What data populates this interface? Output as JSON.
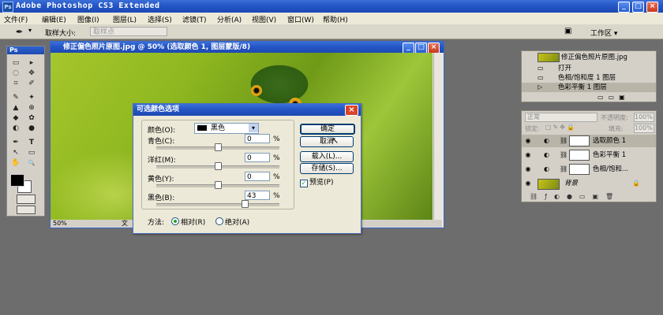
{
  "app": {
    "title": "Adobe Photoshop CS3 Extended",
    "logo": "Ps",
    "window_buttons": [
      "_",
      "□",
      "×"
    ]
  },
  "menu": [
    "文件(F)",
    "编辑(E)",
    "图像(I)",
    "图层(L)",
    "选择(S)",
    "滤镜(T)",
    "分析(A)",
    "视图(V)",
    "窗口(W)",
    "帮助(H)"
  ],
  "options_bar": {
    "sample_label": "取样大小:",
    "sample_value": "取样点",
    "workspace_label": "工作区 ▾"
  },
  "toolbox": {
    "header": "Ps",
    "tools": [
      "▭",
      "▸",
      "◌",
      "✥",
      "⌗",
      "✐",
      "✎",
      "✦",
      "▲",
      "⊕",
      "◆",
      "✿",
      "◐",
      "●",
      "✒",
      "T",
      "↖",
      "▭",
      "✋",
      "🔍"
    ]
  },
  "document": {
    "title": "修正偏色照片原图.jpg @ 50% (选取颜色 1, 图层蒙版/8)",
    "zoom": "50%",
    "status_fragment": "文"
  },
  "dialog": {
    "title": "可选颜色选项",
    "color_label": "颜色(O):",
    "color_value": "黑色",
    "sliders": [
      {
        "label": "青色(C):",
        "value": "0",
        "unit": "%",
        "level": 0.5
      },
      {
        "label": "洋红(M):",
        "value": "0",
        "unit": "%",
        "level": 0.5
      },
      {
        "label": "黄色(Y):",
        "value": "0",
        "unit": "%",
        "level": 0.5
      },
      {
        "label": "黑色(B):",
        "value": "43",
        "unit": "%",
        "level": 0.715
      }
    ],
    "buttons": {
      "ok": "确定",
      "cancel": "取消",
      "load": "载入(L)...",
      "save": "存储(S)..."
    },
    "preview_label": "预览(P)",
    "method_label": "方法:",
    "relative_label": "相对(R)",
    "absolute_label": "绝对(A)"
  },
  "history_panel": {
    "snapshot": "修正偏色照片原图.jpg",
    "items": [
      "打开",
      "色相/饱和度 1 图层",
      "色彩平衡 1 图层"
    ]
  },
  "layers_panel": {
    "blend_mode": "正常",
    "opacity_label": "不透明度:",
    "opacity_value": "100%",
    "lock_label": "锁定:",
    "fill_label": "填充:",
    "fill_value": "100%",
    "layers": [
      {
        "name": "选取颜色 1",
        "selected": true
      },
      {
        "name": "色彩平衡 1",
        "selected": false
      },
      {
        "name": "色相/饱和...",
        "selected": false
      },
      {
        "name": "背景",
        "selected": false
      }
    ]
  }
}
